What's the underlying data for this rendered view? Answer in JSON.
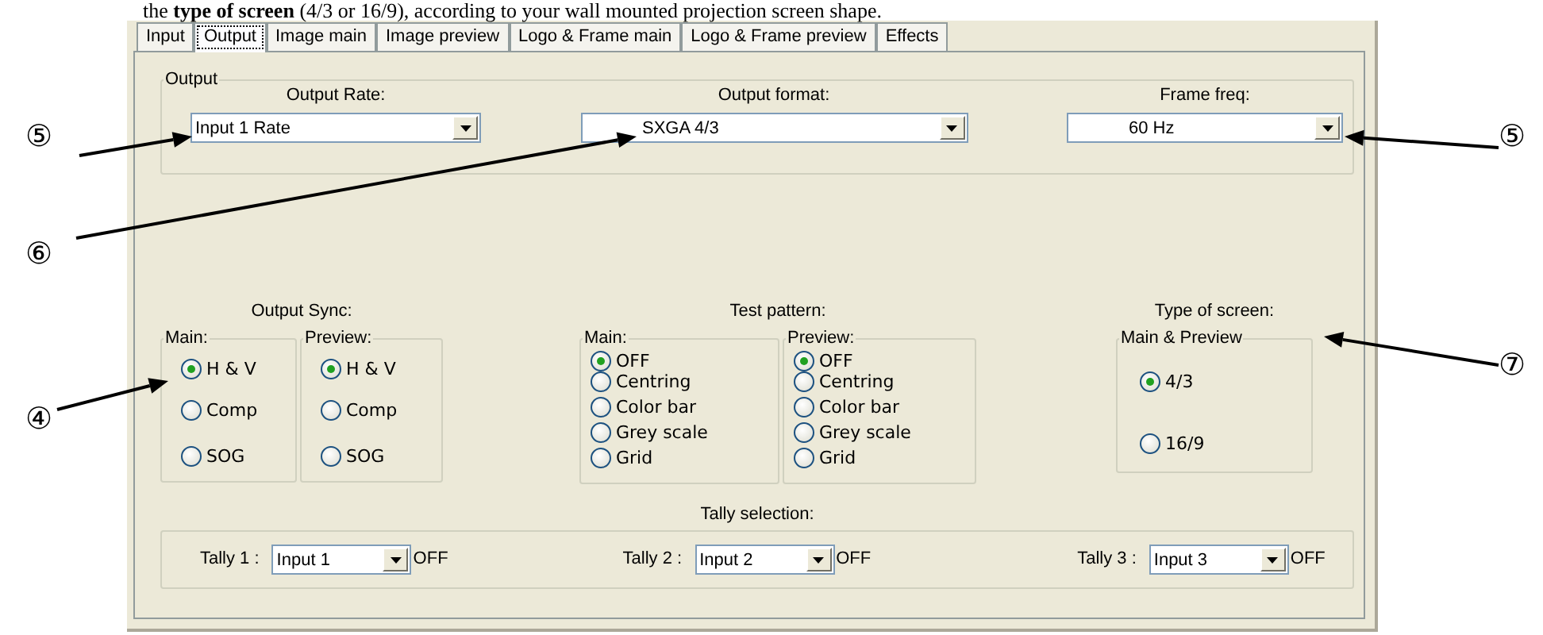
{
  "intro": {
    "text": "the **type of screen** (4/3 or 16/9), according to your wall mounted projection screen shape."
  },
  "tabs": [
    {
      "label": "Input",
      "selected": false
    },
    {
      "label": "Output",
      "selected": true
    },
    {
      "label": "Image main",
      "selected": false
    },
    {
      "label": "Image preview",
      "selected": false
    },
    {
      "label": "Logo & Frame main",
      "selected": false
    },
    {
      "label": "Logo & Frame preview",
      "selected": false
    },
    {
      "label": "Effects",
      "selected": false
    }
  ],
  "output_group": {
    "title": "Output",
    "fields": [
      {
        "label": "Output Rate:",
        "value": "Input 1 Rate"
      },
      {
        "label": "Output format:",
        "value": "SXGA 4/3"
      },
      {
        "label": "Frame freq:",
        "value": "60 Hz"
      }
    ]
  },
  "sections": [
    {
      "title": "Output Sync:",
      "groups": [
        {
          "title": "Main:",
          "options": [
            {
              "label": "H & V",
              "selected": true
            },
            {
              "label": "Comp",
              "selected": false
            },
            {
              "label": "SOG",
              "selected": false
            }
          ]
        },
        {
          "title": "Preview:",
          "options": [
            {
              "label": "H & V",
              "selected": true
            },
            {
              "label": "Comp",
              "selected": false
            },
            {
              "label": "SOG",
              "selected": false
            }
          ]
        }
      ]
    },
    {
      "title": "Test pattern:",
      "groups": [
        {
          "title": "Main:",
          "options": [
            {
              "label": "OFF",
              "selected": true
            },
            {
              "label": "Centring",
              "selected": false
            },
            {
              "label": "Color bar",
              "selected": false
            },
            {
              "label": "Grey scale",
              "selected": false
            },
            {
              "label": "Grid",
              "selected": false
            }
          ]
        },
        {
          "title": "Preview:",
          "options": [
            {
              "label": "OFF",
              "selected": true
            },
            {
              "label": "Centring",
              "selected": false
            },
            {
              "label": "Color bar",
              "selected": false
            },
            {
              "label": "Grey scale",
              "selected": false
            },
            {
              "label": "Grid",
              "selected": false
            }
          ]
        }
      ]
    },
    {
      "title": "Type of screen:",
      "groups": [
        {
          "title": "Main & Preview",
          "options": [
            {
              "label": "4/3",
              "selected": true
            },
            {
              "label": "16/9",
              "selected": false
            }
          ]
        }
      ]
    }
  ],
  "tally": {
    "title": "Tally selection:",
    "items": [
      {
        "label": "Tally 1 :",
        "value": "Input 1",
        "status": "OFF"
      },
      {
        "label": "Tally 2 :",
        "value": "Input 2",
        "status": "OFF"
      },
      {
        "label": "Tally 3 :",
        "value": "Input 3",
        "status": "OFF"
      }
    ]
  },
  "callouts": [
    {
      "label": "⑤"
    },
    {
      "label": "⑤"
    },
    {
      "label": "⑥"
    },
    {
      "label": "⑦"
    },
    {
      "label": "④"
    }
  ]
}
